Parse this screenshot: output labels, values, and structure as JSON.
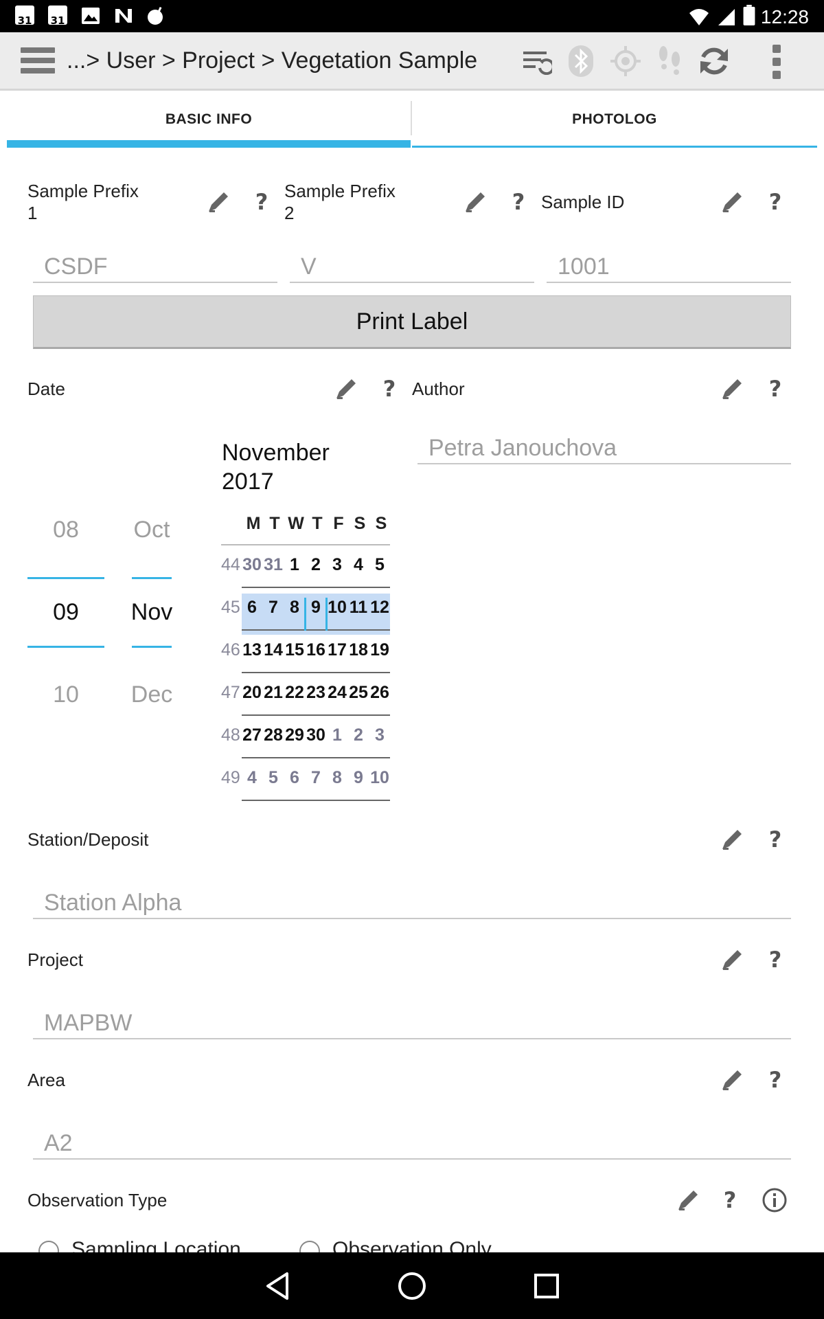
{
  "status_bar": {
    "cal_icon_1": "31",
    "cal_icon_2": "31",
    "time": "12:28"
  },
  "app_bar": {
    "breadcrumb": "...> User > Project > Vegetation Sample",
    "icons": [
      "menu-icon",
      "sync-settings-icon",
      "bluetooth-icon",
      "gps-icon",
      "footsteps-icon",
      "refresh-icon",
      "overflow-icon"
    ]
  },
  "tabs": {
    "basic_info": "BASIC INFO",
    "photolog": "PHOTOLOG"
  },
  "form": {
    "sample_prefix_1": {
      "label_line1": "Sample Prefix",
      "label_line2": "1",
      "value": "CSDF"
    },
    "sample_prefix_2": {
      "label_line1": "Sample Prefix",
      "label_line2": "2",
      "value": "V"
    },
    "sample_id": {
      "label": "Sample ID",
      "value": "1001"
    },
    "print_label": "Print Label",
    "date": {
      "label": "Date",
      "day_prev": "08",
      "day_sel": "09",
      "day_next": "10",
      "month_prev": "Oct",
      "month_sel": "Nov",
      "month_next": "Dec",
      "calendar_title_line1": "November",
      "calendar_title_line2": "2017",
      "weekdays": [
        "M",
        "T",
        "W",
        "T",
        "F",
        "S",
        "S"
      ],
      "weeks": [
        {
          "week": "44",
          "days": [
            "30",
            "31",
            "1",
            "2",
            "3",
            "4",
            "5"
          ],
          "dim": [
            true,
            true,
            false,
            false,
            false,
            false,
            false
          ]
        },
        {
          "week": "45",
          "days": [
            "6",
            "7",
            "8",
            "9",
            "10",
            "11",
            "12"
          ],
          "dim": [
            false,
            false,
            false,
            false,
            false,
            false,
            false
          ]
        },
        {
          "week": "46",
          "days": [
            "13",
            "14",
            "15",
            "16",
            "17",
            "18",
            "19"
          ],
          "dim": [
            false,
            false,
            false,
            false,
            false,
            false,
            false
          ]
        },
        {
          "week": "47",
          "days": [
            "20",
            "21",
            "22",
            "23",
            "24",
            "25",
            "26"
          ],
          "dim": [
            false,
            false,
            false,
            false,
            false,
            false,
            false
          ]
        },
        {
          "week": "48",
          "days": [
            "27",
            "28",
            "29",
            "30",
            "1",
            "2",
            "3"
          ],
          "dim": [
            false,
            false,
            false,
            false,
            true,
            true,
            true
          ]
        },
        {
          "week": "49",
          "days": [
            "4",
            "5",
            "6",
            "7",
            "8",
            "9",
            "10"
          ],
          "dim": [
            true,
            true,
            true,
            true,
            true,
            true,
            true
          ]
        }
      ],
      "selected_day": "9"
    },
    "author": {
      "label": "Author",
      "value": "Petra Janouchova"
    },
    "station": {
      "label": "Station/Deposit",
      "value": "Station Alpha"
    },
    "project": {
      "label": "Project",
      "value": "MAPBW"
    },
    "area": {
      "label": "Area",
      "value": "A2"
    },
    "observation_type": {
      "label": "Observation Type",
      "options": [
        "Sampling Location",
        "Observation Only"
      ]
    }
  },
  "colors": {
    "accent": "#36b4e5",
    "selected_week_bg": "#c7dcf5",
    "appbar_bg": "#ececec",
    "button_bg": "#d6d6d6"
  }
}
